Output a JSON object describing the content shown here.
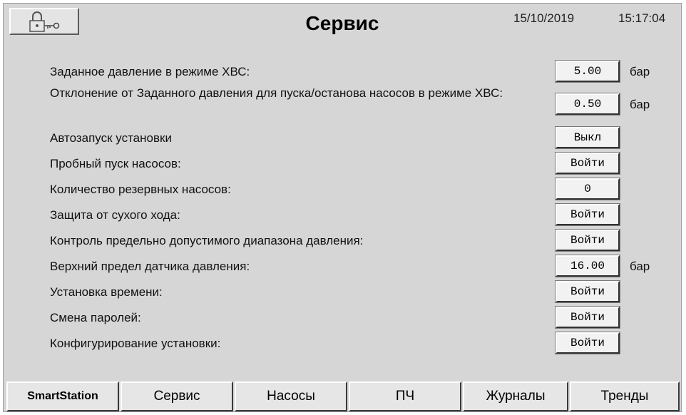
{
  "header": {
    "title": "Сервис",
    "date": "15/10/2019",
    "time": "15:17:04",
    "lock_icon": "padlock-key-icon"
  },
  "settings": [
    {
      "label": "Заданное давление в режиме ХВС:",
      "value": "5.00",
      "unit": "бар"
    },
    {
      "label": "Отклонение от Заданного давления для пуска/останова насосов в режиме ХВС:",
      "value": "0.50",
      "unit": "бар"
    },
    {
      "label": "Автозапуск установки",
      "value": "Выкл",
      "unit": ""
    },
    {
      "label": "Пробный пуск насосов:",
      "value": "Войти",
      "unit": ""
    },
    {
      "label": "Количество резервных насосов:",
      "value": "0",
      "unit": ""
    },
    {
      "label": "Защита от сухого хода:",
      "value": "Войти",
      "unit": ""
    },
    {
      "label": "Контроль предельно допустимого диапазона давления:",
      "value": "Войти",
      "unit": ""
    },
    {
      "label": "Верхний предел датчика давления:",
      "value": "16.00",
      "unit": "бар"
    },
    {
      "label": "Установка времени:",
      "value": "Войти",
      "unit": ""
    },
    {
      "label": "Смена паролей:",
      "value": "Войти",
      "unit": ""
    },
    {
      "label": "Конфигурирование установки:",
      "value": "Войти",
      "unit": ""
    }
  ],
  "tabs": [
    {
      "label": "SmartStation"
    },
    {
      "label": "Сервис"
    },
    {
      "label": "Насосы"
    },
    {
      "label": "ПЧ"
    },
    {
      "label": "Журналы"
    },
    {
      "label": "Тренды"
    }
  ],
  "colors": {
    "panel_bg": "#d6d6d6",
    "button_bg": "#f2f2f2"
  }
}
